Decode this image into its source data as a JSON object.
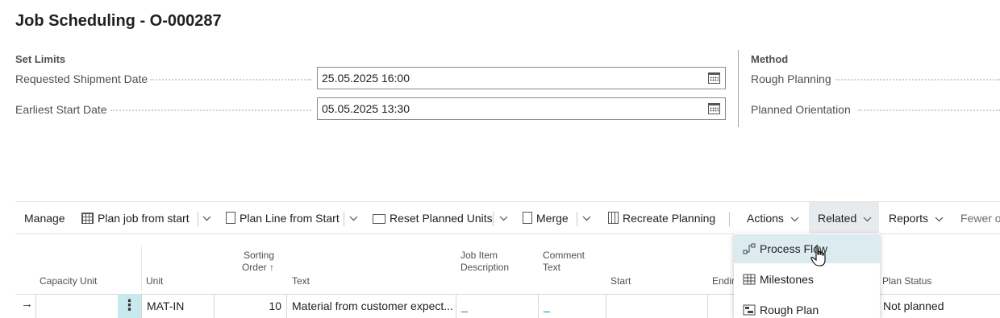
{
  "page": {
    "title": "Job Scheduling - O-000287"
  },
  "set_limits": {
    "heading": "Set Limits",
    "fields": [
      {
        "label": "Requested Shipment Date",
        "value": "25.05.2025 16:00"
      },
      {
        "label": "Earliest Start Date",
        "value": "05.05.2025 13:30"
      }
    ]
  },
  "method": {
    "heading": "Method",
    "fields": [
      {
        "label": "Rough Planning"
      },
      {
        "label": "Planned Orientation"
      }
    ]
  },
  "actionbar": {
    "manage": "Manage",
    "plan_job": "Plan job from start",
    "plan_line": "Plan Line from Start",
    "reset_units": "Reset Planned Units",
    "merge": "Merge",
    "recreate": "Recreate Planning",
    "actions": "Actions",
    "related": "Related",
    "reports": "Reports",
    "fewer": "Fewer o"
  },
  "related_menu": {
    "items": [
      {
        "label": "Process Flow",
        "icon": "process-flow-icon"
      },
      {
        "label": "Milestones",
        "icon": "milestones-icon"
      },
      {
        "label": "Rough Plan",
        "icon": "rough-plan-icon"
      }
    ]
  },
  "grid": {
    "columns": {
      "capacity_unit": "Capacity Unit",
      "unit": "Unit",
      "sorting_order_1": "Sorting",
      "sorting_order_2": "Order",
      "sort_arrow": "↑",
      "text": "Text",
      "job_item_desc_1": "Job Item",
      "job_item_desc_2": "Description",
      "comment_text_1": "Comment",
      "comment_text_2": "Text",
      "start": "Start",
      "ending": "Endin",
      "plan_status": "Plan Status"
    },
    "rows": [
      {
        "arrow": "→",
        "capacity_unit": "",
        "kebab": "⋮",
        "unit": "MAT-IN",
        "sorting_order": "10",
        "text": "Material from customer expect...",
        "job_item_description": "_",
        "comment_text": "_",
        "start": "",
        "plan_status": "Not planned"
      }
    ]
  }
}
